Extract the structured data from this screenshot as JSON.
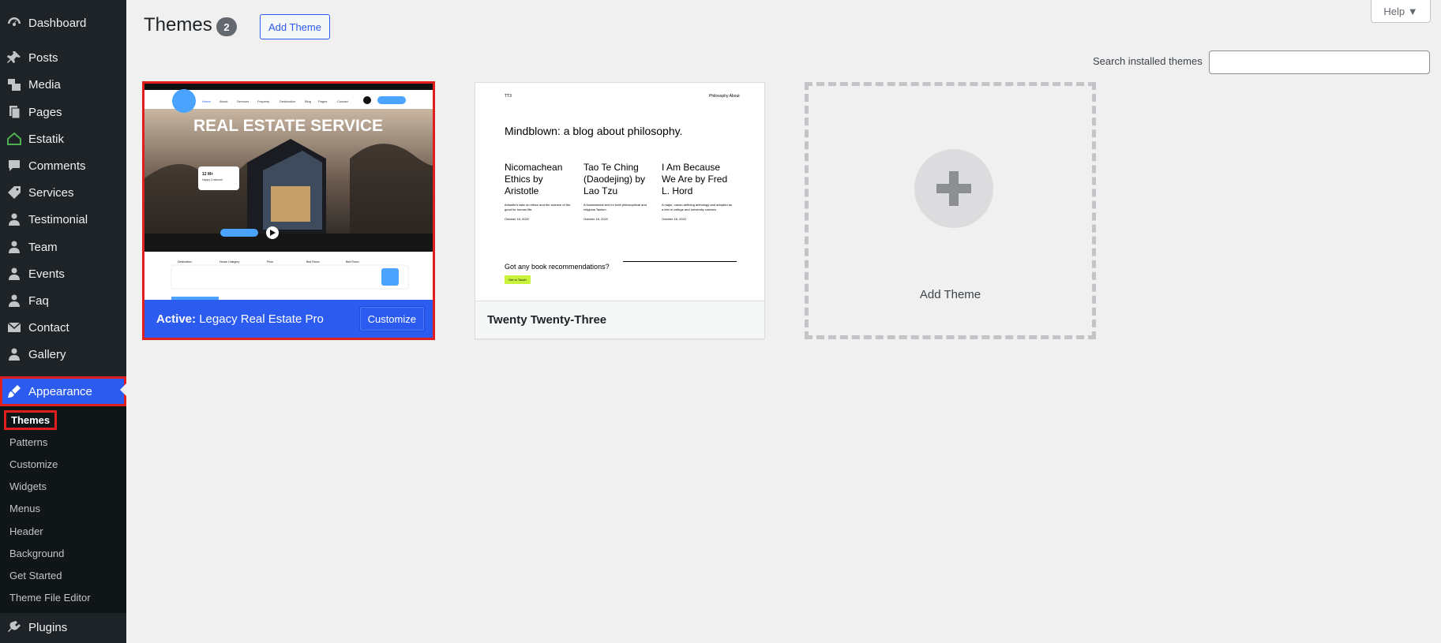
{
  "sidebar": {
    "items": [
      {
        "label": "Dashboard",
        "icon": "dashboard-icon"
      },
      {
        "label": "Posts",
        "icon": "pin-icon"
      },
      {
        "label": "Media",
        "icon": "media-icon"
      },
      {
        "label": "Pages",
        "icon": "pages-icon"
      },
      {
        "label": "Estatik",
        "icon": "house-icon"
      },
      {
        "label": "Comments",
        "icon": "comment-icon"
      },
      {
        "label": "Services",
        "icon": "tag-icon"
      },
      {
        "label": "Testimonial",
        "icon": "person-icon"
      },
      {
        "label": "Team",
        "icon": "person-icon"
      },
      {
        "label": "Events",
        "icon": "person-icon"
      },
      {
        "label": "Faq",
        "icon": "person-icon"
      },
      {
        "label": "Contact",
        "icon": "mail-icon"
      },
      {
        "label": "Gallery",
        "icon": "person-icon"
      }
    ],
    "active": {
      "label": "Appearance",
      "icon": "brush-icon"
    },
    "submenu": [
      "Themes",
      "Patterns",
      "Customize",
      "Widgets",
      "Menus",
      "Header",
      "Background",
      "Get Started",
      "Theme File Editor"
    ],
    "plugins": {
      "label": "Plugins",
      "icon": "plugin-icon"
    }
  },
  "header": {
    "title": "Themes",
    "count": "2",
    "add_button": "Add Theme",
    "help": "Help ▼"
  },
  "search": {
    "label": "Search installed themes",
    "value": ""
  },
  "themes": {
    "active": {
      "prefix": "Active:",
      "name": "Legacy Real Estate Pro",
      "customize": "Customize",
      "preview": {
        "hero": "REAL ESTATE SERVICE",
        "nav": [
          "Home",
          "About",
          "Services",
          "Property",
          "Destination",
          "Blog",
          "Pages",
          "Contact"
        ],
        "stat": "12 M+",
        "stat_sub": "Happy Customer",
        "search_fields": [
          "Destination",
          "House Category",
          "Price",
          "Bed Room",
          "Bed Room"
        ]
      }
    },
    "tt3": {
      "name": "Twenty Twenty-Three",
      "preview": {
        "logo": "TT3",
        "nav": "Philosophy   About",
        "headline": "Mindblown: a blog about philosophy.",
        "posts": [
          {
            "title": "Nicomachean Ethics by Aristotle",
            "excerpt": "Aristotle's take on ethics and the science of the good for human life.",
            "date": "October 18, 2022"
          },
          {
            "title": "Tao Te Ching (Daodejing) by Lao Tzu",
            "excerpt": "A fundamental text for both philosophical and religious Taoism.",
            "date": "October 18, 2022"
          },
          {
            "title": "I Am Because We Are by Fred L. Hord",
            "excerpt": "A major, canon-defining anthology and adopted as a text in college and university courses.",
            "date": "October 18, 2022"
          }
        ],
        "cta": "Got any book recommendations?",
        "cta_button": "Get In Touch"
      }
    },
    "add": {
      "label": "Add Theme"
    }
  },
  "colors": {
    "accent": "#2c5bf0",
    "sidebar": "#1d2327",
    "highlight": "#e01e1e"
  }
}
